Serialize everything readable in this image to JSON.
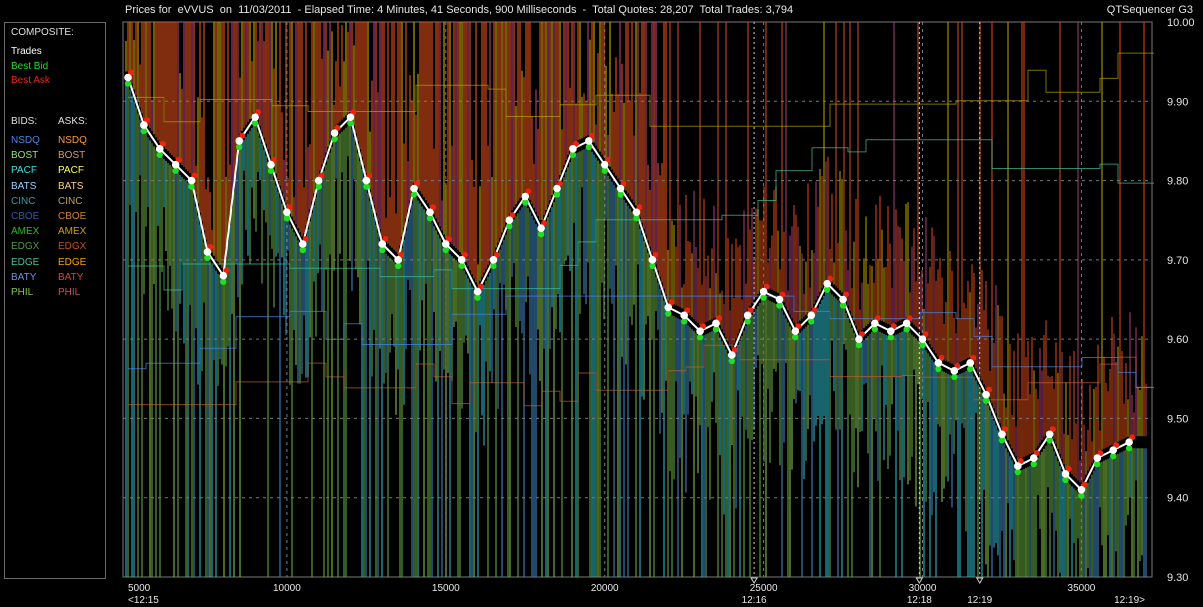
{
  "header": {
    "title": "Prices for  eVVUS  on  11/03/2011  - Elapsed Time: 4 Minutes, 41 Seconds, 900 Milliseconds  -  Total Quotes: 28,207  Total Trades: 3,794",
    "app_name": "QTSequencer G3"
  },
  "legend": {
    "composite_heading": "COMPOSITE:",
    "composite": [
      {
        "label": "Trades",
        "color": "#ffffff"
      },
      {
        "label": "Best Bid",
        "color": "#22dd22"
      },
      {
        "label": "Best Ask",
        "color": "#ee2211"
      }
    ],
    "bids_heading": "BIDS:",
    "asks_heading": "ASKS:",
    "exchanges": [
      {
        "bid": "NSDQ",
        "bid_color": "#4a86e8",
        "ask": "NSDQ",
        "ask_color": "#ff9a3c"
      },
      {
        "bid": "BOST",
        "bid_color": "#98e070",
        "ask": "BOST",
        "ask_color": "#d89a6a"
      },
      {
        "bid": "PACF",
        "bid_color": "#40e0e0",
        "ask": "PACF",
        "ask_color": "#ffff55"
      },
      {
        "bid": "BATS",
        "bid_color": "#9ad0ff",
        "ask": "BATS",
        "ask_color": "#ffd080"
      },
      {
        "bid": "CINC",
        "bid_color": "#3a9aa8",
        "ask": "CINC",
        "ask_color": "#c0a060"
      },
      {
        "bid": "CBOE",
        "bid_color": "#2a5aa8",
        "ask": "CBOE",
        "ask_color": "#d08030"
      },
      {
        "bid": "AMEX",
        "bid_color": "#22c020",
        "ask": "AMEX",
        "ask_color": "#d0a000"
      },
      {
        "bid": "EDGX",
        "bid_color": "#4a9a4a",
        "ask": "EDGX",
        "ask_color": "#c05020"
      },
      {
        "bid": "EDGE",
        "bid_color": "#40c0a0",
        "ask": "EDGE",
        "ask_color": "#ffa000"
      },
      {
        "bid": "BATY",
        "bid_color": "#7090e0",
        "ask": "BATY",
        "ask_color": "#e04040"
      },
      {
        "bid": "PHIL",
        "bid_color": "#8ac050",
        "ask": "PHIL",
        "ask_color": "#c05060"
      }
    ]
  },
  "colors": {
    "background": "#000000",
    "grid": "#7a7a7a",
    "trade": "#ffffff",
    "best_bid": "#22dd22",
    "best_ask": "#ee2211",
    "ask_band": "#d84a18",
    "ask_band2": "#a83a78",
    "ask_band3": "#b8a000",
    "bid_band": "#5a9a3a",
    "bid_band2": "#3a7ab0"
  },
  "chart_data": {
    "type": "line",
    "title": "",
    "xlabel": "",
    "ylabel": "",
    "x_range": [
      5000,
      37000
    ],
    "ylim": [
      9.3,
      10.0
    ],
    "grid": true,
    "y_ticks": [
      "10.00",
      "9.90",
      "9.80",
      "9.70",
      "9.60",
      "9.50",
      "9.40",
      "9.30"
    ],
    "x_ticks": [
      {
        "value": 5000,
        "label": "5000"
      },
      {
        "value": 10000,
        "label": "10000"
      },
      {
        "value": 15000,
        "label": "15000"
      },
      {
        "value": 20000,
        "label": "20000"
      },
      {
        "value": 25000,
        "label": "25000"
      },
      {
        "value": 30000,
        "label": "30000"
      },
      {
        "value": 35000,
        "label": "35000"
      }
    ],
    "time_markers": [
      {
        "value": 5000,
        "label": "<12:15"
      },
      {
        "value": 24700,
        "label": "12:16"
      },
      {
        "value": 29900,
        "label": "12:18"
      },
      {
        "value": 31800,
        "label": "12:19"
      },
      {
        "value": 37000,
        "label": "12:19>"
      }
    ],
    "series": [
      {
        "name": "Trades",
        "x": [
          5000,
          5500,
          6000,
          6500,
          7000,
          7500,
          8000,
          8500,
          9000,
          9500,
          10000,
          10500,
          11000,
          11500,
          12000,
          12500,
          13000,
          13500,
          14000,
          14500,
          15000,
          15500,
          16000,
          16500,
          17000,
          17500,
          18000,
          18500,
          19000,
          19500,
          20000,
          20500,
          21000,
          21500,
          22000,
          22500,
          23000,
          23500,
          24000,
          24500,
          25000,
          25500,
          26000,
          26500,
          27000,
          27500,
          28000,
          28500,
          29000,
          29500,
          30000,
          30500,
          31000,
          31500,
          32000,
          32500,
          33000,
          33500,
          34000,
          34500,
          35000,
          35500,
          36000,
          36500
        ],
        "y": [
          9.93,
          9.87,
          9.84,
          9.82,
          9.8,
          9.71,
          9.68,
          9.85,
          9.88,
          9.82,
          9.76,
          9.72,
          9.8,
          9.86,
          9.88,
          9.8,
          9.72,
          9.7,
          9.79,
          9.76,
          9.72,
          9.7,
          9.66,
          9.7,
          9.75,
          9.78,
          9.74,
          9.79,
          9.84,
          9.85,
          9.82,
          9.79,
          9.76,
          9.7,
          9.64,
          9.63,
          9.61,
          9.62,
          9.58,
          9.63,
          9.66,
          9.65,
          9.61,
          9.63,
          9.67,
          9.65,
          9.6,
          9.62,
          9.61,
          9.62,
          9.6,
          9.57,
          9.56,
          9.57,
          9.53,
          9.48,
          9.44,
          9.45,
          9.48,
          9.43,
          9.41,
          9.45,
          9.46,
          9.47
        ]
      }
    ]
  }
}
